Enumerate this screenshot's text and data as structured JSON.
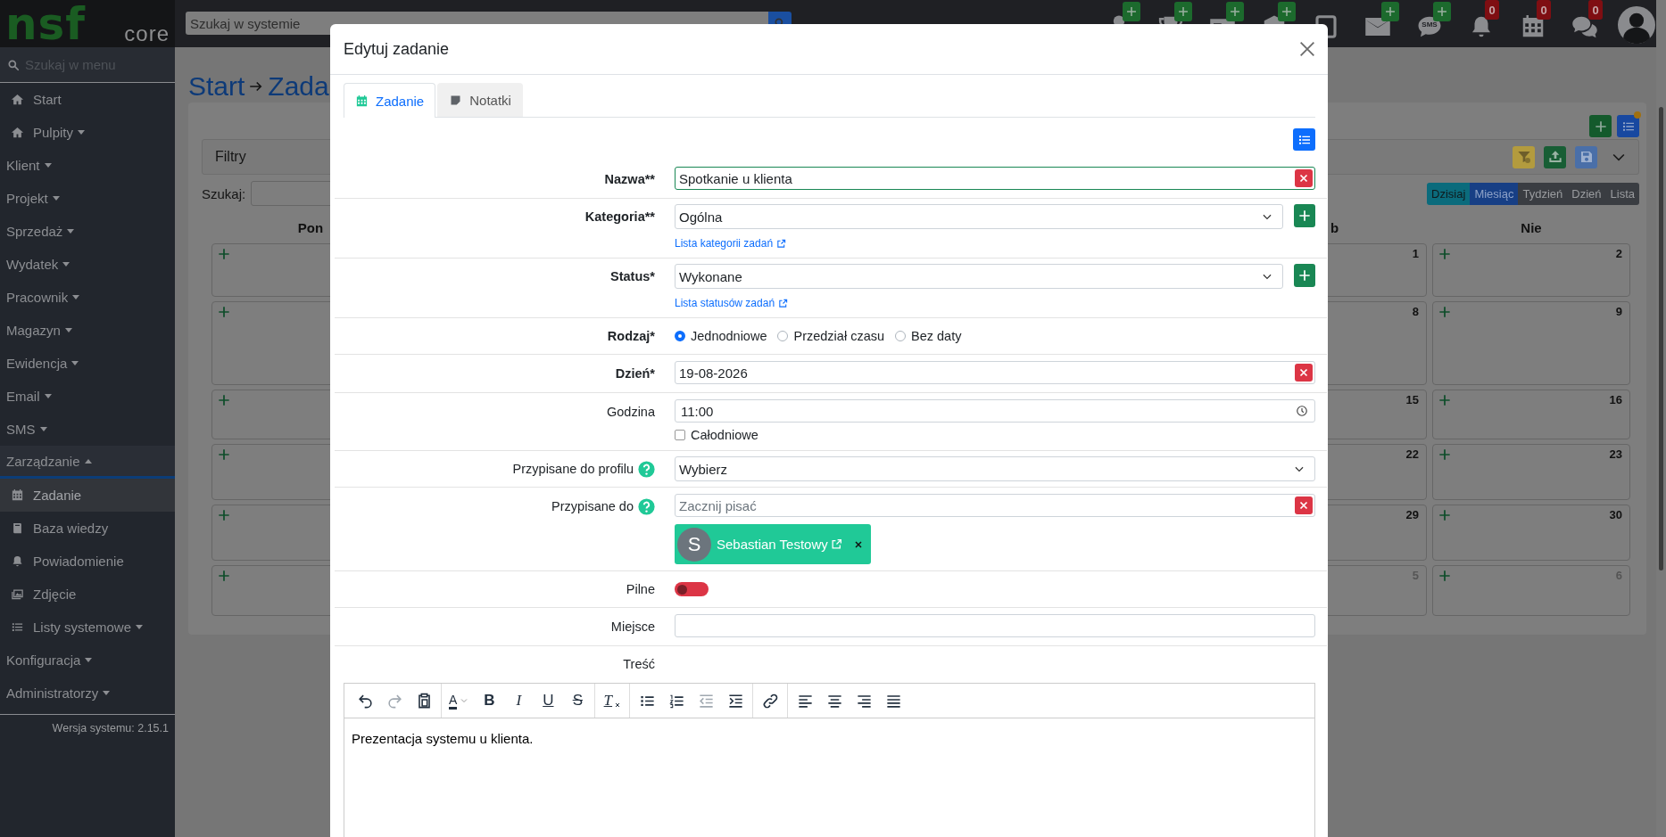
{
  "logo": {
    "main": "nsf",
    "sub": "core"
  },
  "top_search": {
    "placeholder": "Szukaj w systemie"
  },
  "top_icons": [
    {
      "kind": "user",
      "add": true
    },
    {
      "kind": "trophy",
      "add": true
    },
    {
      "kind": "card",
      "add": true
    },
    {
      "kind": "box",
      "add": true
    },
    {
      "kind": "square",
      "add": false
    },
    {
      "kind": "mail",
      "add": true
    },
    {
      "kind": "sms",
      "label": "SMS",
      "add": true
    },
    {
      "kind": "bell",
      "count": "0",
      "add": false
    },
    {
      "kind": "calendar",
      "count": "0",
      "add": false
    },
    {
      "kind": "chat",
      "count": "0",
      "add": false
    },
    {
      "kind": "avatar",
      "add": false
    }
  ],
  "sidebar": {
    "search_placeholder": "Szukaj w menu",
    "items": [
      {
        "label": "Start",
        "dropdown": false,
        "expanded": false,
        "selected": false
      },
      {
        "label": "Pulpity",
        "dropdown": true,
        "expanded": false,
        "selected": false
      },
      {
        "label": "Klient",
        "dropdown": true,
        "expanded": false,
        "selected": false
      },
      {
        "label": "Projekt",
        "dropdown": true,
        "expanded": false,
        "selected": false
      },
      {
        "label": "Sprzedaż",
        "dropdown": true,
        "expanded": false,
        "selected": false
      },
      {
        "label": "Wydatek",
        "dropdown": true,
        "expanded": false,
        "selected": false
      },
      {
        "label": "Pracownik",
        "dropdown": true,
        "expanded": false,
        "selected": false
      },
      {
        "label": "Magazyn",
        "dropdown": true,
        "expanded": false,
        "selected": false
      },
      {
        "label": "Ewidencja",
        "dropdown": true,
        "expanded": false,
        "selected": false
      },
      {
        "label": "Email",
        "dropdown": true,
        "expanded": false,
        "selected": false
      },
      {
        "label": "SMS",
        "dropdown": true,
        "expanded": false,
        "selected": false
      },
      {
        "label": "Zarządzanie",
        "dropdown": true,
        "expanded": true,
        "selected": false,
        "children": [
          {
            "label": "Zadanie",
            "dropdown": false,
            "selected": true
          },
          {
            "label": "Baza wiedzy",
            "dropdown": false,
            "selected": false
          },
          {
            "label": "Powiadomienie",
            "dropdown": false,
            "selected": false
          },
          {
            "label": "Zdjęcie",
            "dropdown": false,
            "selected": false
          },
          {
            "label": "Listy systemowe",
            "dropdown": true,
            "selected": false
          }
        ]
      },
      {
        "label": "Konfiguracja",
        "dropdown": true,
        "expanded": false,
        "selected": false
      },
      {
        "label": "Administratorzy",
        "dropdown": true,
        "expanded": false,
        "selected": false
      }
    ],
    "version": "Wersja systemu: 2.15.1"
  },
  "page": {
    "breadcrumb": {
      "home": "Start",
      "current": "Zada"
    },
    "filters_label": "Filtry",
    "search_label": "Szukaj:",
    "views": [
      {
        "label": "Dzisiaj",
        "kind": "today",
        "selected": false
      },
      {
        "label": "Miesiąc",
        "kind": "view",
        "selected": true
      },
      {
        "label": "Tydzień",
        "kind": "view",
        "selected": false
      },
      {
        "label": "Dzień",
        "kind": "view",
        "selected": false
      },
      {
        "label": "Lista",
        "kind": "view",
        "selected": false
      }
    ]
  },
  "calendar": {
    "columns": [
      {
        "header": "Pon",
        "cut": false,
        "add": true
      },
      {
        "header": "b",
        "cut": true,
        "add": false,
        "days": [
          {
            "n": "1",
            "muted": false
          },
          {
            "n": "8",
            "muted": false
          },
          {
            "n": "15",
            "muted": false
          },
          {
            "n": "22",
            "muted": false
          },
          {
            "n": "29",
            "muted": false
          },
          {
            "n": "5",
            "muted": true
          }
        ]
      },
      {
        "header": "Nie",
        "cut": false,
        "add": true,
        "days": [
          {
            "n": "2",
            "muted": false
          },
          {
            "n": "9",
            "muted": false
          },
          {
            "n": "16",
            "muted": false
          },
          {
            "n": "23",
            "muted": false
          },
          {
            "n": "30",
            "muted": false
          },
          {
            "n": "6",
            "muted": true
          }
        ]
      }
    ]
  },
  "modal": {
    "title": "Edytuj zadanie",
    "tabs": [
      {
        "label": "Zadanie",
        "selected": true
      },
      {
        "label": "Notatki",
        "selected": false
      }
    ],
    "fields": [
      {
        "kind": "text",
        "label": "Nazwa**",
        "required": true,
        "help": false,
        "value": "Spotkanie u klienta",
        "valid": true,
        "clear": true
      },
      {
        "kind": "select",
        "label": "Kategoria**",
        "required": true,
        "help": false,
        "value": "Ogólna",
        "add": true,
        "link": "Lista kategorii zadań"
      },
      {
        "kind": "select",
        "label": "Status*",
        "required": true,
        "help": false,
        "value": "Wykonane",
        "add": true,
        "link": "Lista statusów zadań"
      },
      {
        "kind": "radio",
        "label": "Rodzaj*",
        "required": true,
        "help": false,
        "options": [
          {
            "label": "Jednodniowe",
            "selected": true
          },
          {
            "label": "Przedział czasu",
            "selected": false
          },
          {
            "label": "Bez daty",
            "selected": false
          }
        ]
      },
      {
        "kind": "text",
        "label": "Dzień*",
        "required": true,
        "help": false,
        "value": "19-08-2026",
        "valid": false,
        "clear": true
      },
      {
        "kind": "time",
        "label": "Godzina",
        "required": false,
        "help": false,
        "value": "11:00",
        "checkbox": {
          "label": "Całodniowe",
          "checked": false
        }
      },
      {
        "kind": "select",
        "label": "Przypisane do profilu",
        "required": false,
        "help": true,
        "value": "Wybierz",
        "add": false
      },
      {
        "kind": "text",
        "label": "Przypisane do",
        "required": false,
        "help": true,
        "placeholder": "Zacznij pisać",
        "valid": false,
        "clear": true,
        "chips": [
          {
            "initial": "S",
            "name": "Sebastian Testowy"
          }
        ]
      },
      {
        "kind": "switch",
        "label": "Pilne",
        "required": false,
        "help": false,
        "on": false
      },
      {
        "kind": "text",
        "label": "Miejsce",
        "required": false,
        "help": false,
        "valid": false,
        "clear": false
      },
      {
        "kind": "editor",
        "label": "Treść",
        "required": false,
        "help": false,
        "content": "Prezentacja systemu u klienta.",
        "toolbar": [
          [
            {
              "kind": "undo",
              "disabled": false
            },
            {
              "kind": "redo",
              "disabled": true
            },
            {
              "kind": "paste",
              "disabled": false
            }
          ],
          [
            {
              "kind": "color",
              "glyph": "A",
              "disabled": false
            },
            {
              "kind": "bold",
              "glyph": "B",
              "disabled": false
            },
            {
              "kind": "italic",
              "glyph": "I",
              "disabled": false
            },
            {
              "kind": "underline",
              "glyph": "U",
              "disabled": false
            },
            {
              "kind": "strike",
              "glyph": "S",
              "disabled": false
            }
          ],
          [
            {
              "kind": "clear",
              "glyph": "T",
              "disabled": false
            }
          ],
          [
            {
              "kind": "ul",
              "disabled": false
            },
            {
              "kind": "ol",
              "disabled": false
            },
            {
              "kind": "outdent",
              "disabled": true
            },
            {
              "kind": "indent",
              "disabled": false
            }
          ],
          [
            {
              "kind": "link",
              "disabled": false
            }
          ],
          [
            {
              "kind": "alignleft",
              "disabled": false
            },
            {
              "kind": "aligncenter",
              "disabled": false
            },
            {
              "kind": "alignright",
              "disabled": false
            },
            {
              "kind": "justify",
              "disabled": false
            }
          ]
        ]
      }
    ]
  }
}
